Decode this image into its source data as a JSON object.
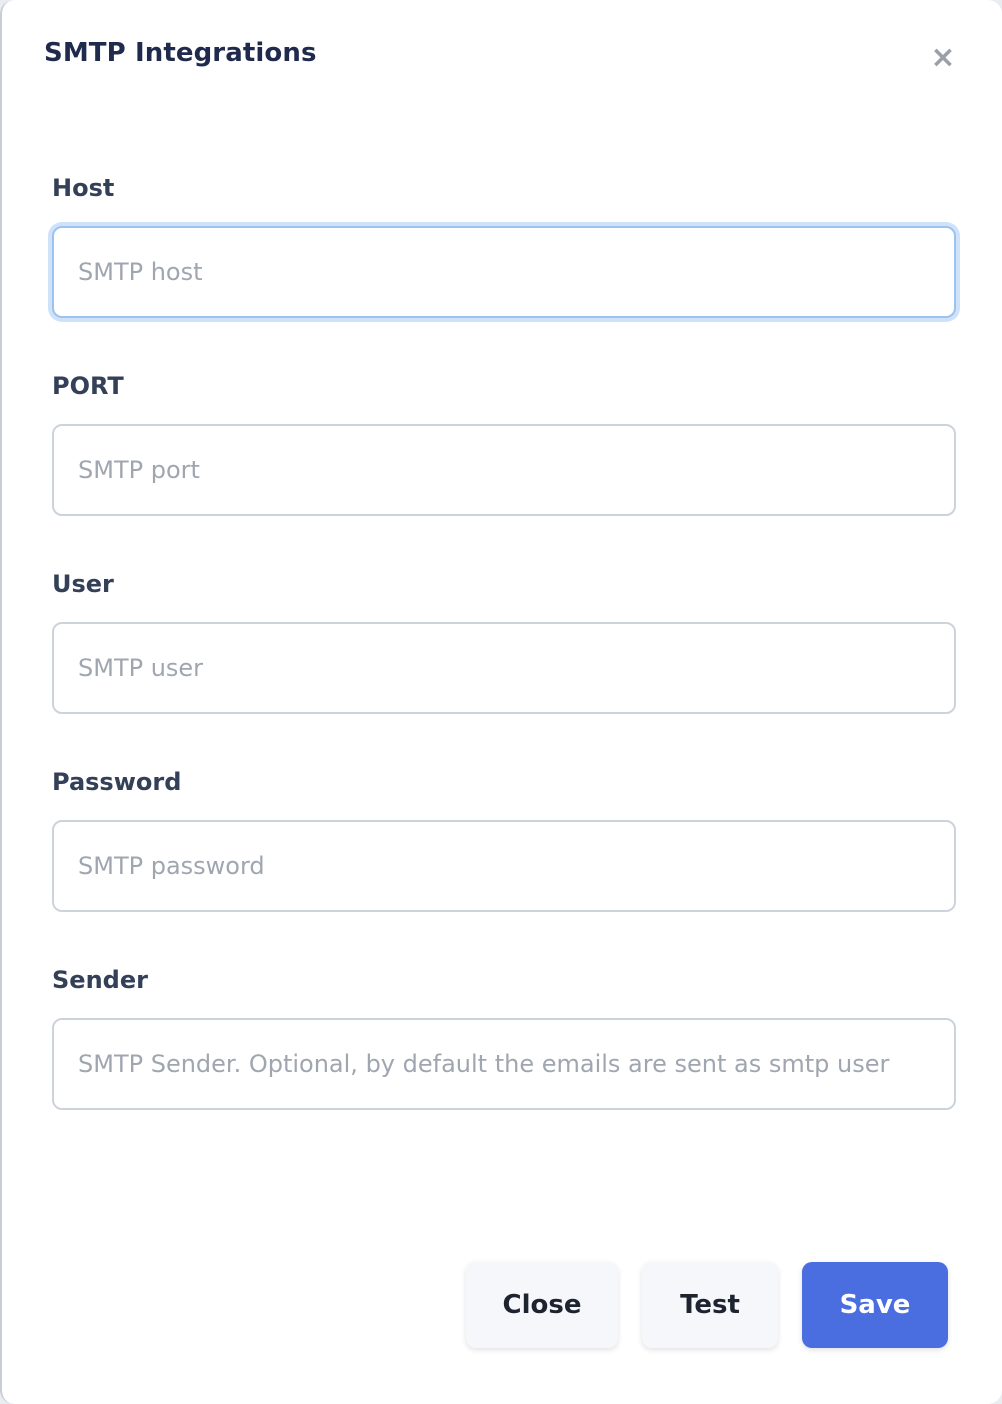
{
  "modal": {
    "title": "SMTP Integrations",
    "close_icon": "close-icon"
  },
  "fields": {
    "host": {
      "label": "Host",
      "placeholder": "SMTP host",
      "value": ""
    },
    "port": {
      "label": "PORT",
      "placeholder": "SMTP port",
      "value": ""
    },
    "user": {
      "label": "User",
      "placeholder": "SMTP user",
      "value": ""
    },
    "password": {
      "label": "Password",
      "placeholder": "SMTP password",
      "value": ""
    },
    "sender": {
      "label": "Sender",
      "placeholder": "SMTP Sender. Optional, by default the emails are sent as smtp user",
      "value": ""
    }
  },
  "actions": {
    "close_label": "Close",
    "test_label": "Test",
    "save_label": "Save"
  },
  "colors": {
    "primary": "#4a6ee0",
    "title": "#1f2a4d",
    "focus_ring": "#cfe2fa"
  }
}
